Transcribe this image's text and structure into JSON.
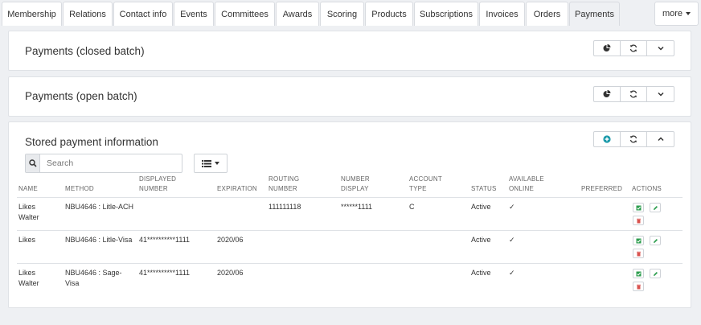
{
  "tabs": [
    {
      "label": "Membership"
    },
    {
      "label": "Relations"
    },
    {
      "label": "Contact info"
    },
    {
      "label": "Events"
    },
    {
      "label": "Committees"
    },
    {
      "label": "Awards"
    },
    {
      "label": "Scoring"
    },
    {
      "label": "Products"
    },
    {
      "label": "Subscriptions"
    },
    {
      "label": "Invoices"
    },
    {
      "label": "Orders"
    },
    {
      "label": "Payments"
    }
  ],
  "active_tab": "Payments",
  "more_label": "more",
  "panels": {
    "closed_batch": {
      "title": "Payments (closed batch)"
    },
    "open_batch": {
      "title": "Payments (open batch)"
    },
    "stored": {
      "title": "Stored payment information"
    }
  },
  "search": {
    "placeholder": "Search",
    "value": ""
  },
  "table": {
    "headers": {
      "name": "NAME",
      "method": "METHOD",
      "displayed_number": "DISPLAYED NUMBER",
      "expiration": "EXPIRATION",
      "routing_number": "ROUTING NUMBER",
      "number_display": "NUMBER DISPLAY",
      "account_type": "ACCOUNT TYPE",
      "status": "STATUS",
      "available_online": "AVAILABLE ONLINE",
      "preferred": "PREFERRED",
      "actions": "ACTIONS"
    },
    "rows": [
      {
        "name": "Likes Walter",
        "method": "NBU4646 : Litle-ACH",
        "displayed_number": "",
        "expiration": "",
        "routing_number": "111111118",
        "number_display": "******1111",
        "account_type": "C",
        "status": "Active",
        "available_online": "✓",
        "preferred": ""
      },
      {
        "name": "Likes",
        "method": "NBU4646 : Litle-Visa",
        "displayed_number": "41**********1111",
        "expiration": "2020/06",
        "routing_number": "",
        "number_display": "",
        "account_type": "",
        "status": "Active",
        "available_online": "✓",
        "preferred": ""
      },
      {
        "name": "Likes Walter",
        "method": "NBU4646 : Sage-Visa",
        "displayed_number": "41**********1111",
        "expiration": "2020/06",
        "routing_number": "",
        "number_display": "",
        "account_type": "",
        "status": "Active",
        "available_online": "✓",
        "preferred": ""
      }
    ]
  },
  "colors": {
    "accent_green": "#2e9e4f",
    "delete_red": "#d9534f",
    "add_teal": "#1b9aaa"
  },
  "icons": {
    "pie": "pie-chart-icon",
    "refresh": "refresh-icon",
    "collapse": "chevron-down-icon",
    "expand": "chevron-up-icon",
    "add": "plus-circle-icon",
    "search": "search-icon",
    "list": "list-icon"
  }
}
